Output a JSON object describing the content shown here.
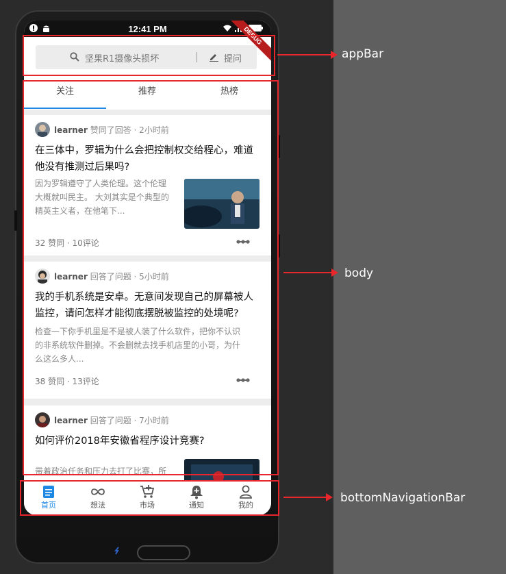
{
  "status_bar": {
    "time": "12:41 PM"
  },
  "debug_banner": "DEBUG",
  "app_bar": {
    "search_placeholder": "坚果R1摄像头损坏",
    "ask_label": "提问"
  },
  "tabs": [
    {
      "label": "关注",
      "active": true
    },
    {
      "label": "推荐",
      "active": false
    },
    {
      "label": "热榜",
      "active": false
    }
  ],
  "feed": [
    {
      "user": "learner",
      "action": "赞同了回答 · 2小时前",
      "title": "在三体中，罗辑为什么会把控制权交给程心，难道他没有推测过后果吗?",
      "excerpt_lines": [
        "因为罗辑遵守了人类伦理。这个伦理",
        "大概就叫民主。 大刘其实是个典型的",
        "精英主义者，在他笔下..."
      ],
      "stats": "32 赞同 · 10评论"
    },
    {
      "user": "learner",
      "action": "回答了问题 · 5小时前",
      "title": "我的手机系统是安卓。无意间发现自己的屏幕被人监控，请问怎样才能彻底摆脱被监控的处境呢?",
      "excerpt_lines": [
        "检查一下你手机里是不是被人装了什么软件，把你不认识",
        "的非系统软件删掉。不会删就去找手机店里的小哥，为什",
        "么这么多人..."
      ],
      "stats": "38 赞同 · 13评论"
    },
    {
      "user": "learner",
      "action": "回答了问题 · 7小时前",
      "title": "如何评价2018年安徽省程序设计竞赛?",
      "excerpt_lines": [
        "带着政治任务和压力去打了比赛，所"
      ],
      "stats": ""
    }
  ],
  "bottom_nav": [
    {
      "label": "首页",
      "icon": "home-icon",
      "active": true
    },
    {
      "label": "想法",
      "icon": "infinity-icon",
      "active": false
    },
    {
      "label": "市场",
      "icon": "cart-icon",
      "active": false
    },
    {
      "label": "通知",
      "icon": "bell-icon",
      "active": false
    },
    {
      "label": "我的",
      "icon": "person-icon",
      "active": false
    }
  ],
  "annotations": {
    "app_bar_label": "appBar",
    "body_label": "body",
    "bottom_nav_label": "bottomNavigationBar",
    "color": "#e8262b"
  },
  "colors": {
    "accent": "#1e88e5",
    "ribbon": "#b71c1c"
  }
}
